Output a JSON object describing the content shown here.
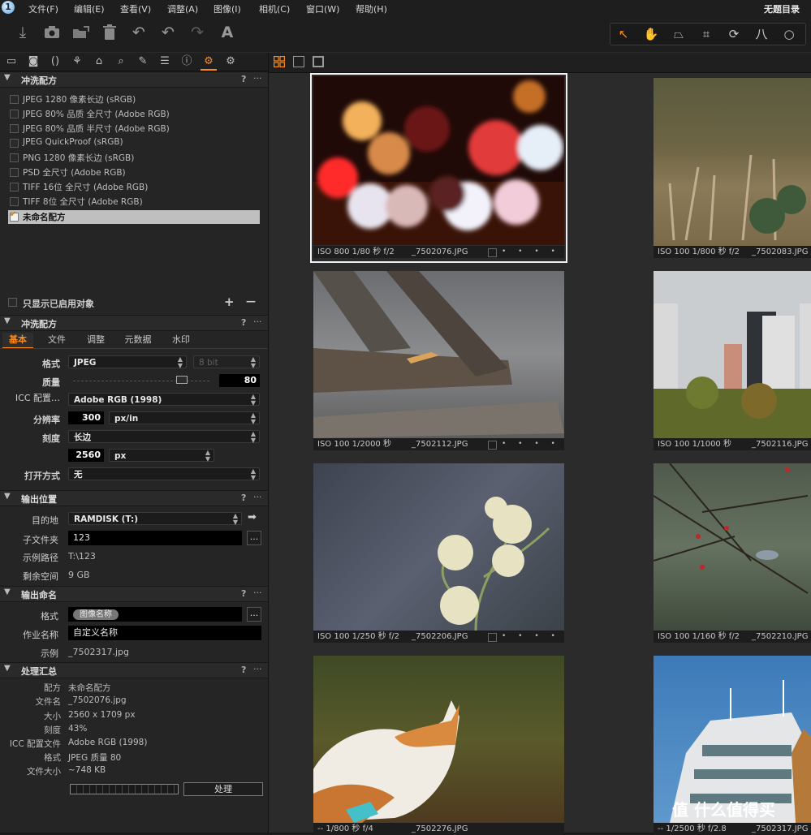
{
  "menubar": {
    "app_icon": "1",
    "items": [
      "文件(F)",
      "编辑(E)",
      "查看(V)",
      "调整(A)",
      "图像(I)",
      "相机(C)",
      "窗口(W)",
      "帮助(H)"
    ],
    "session_title": "无题目录"
  },
  "toolbar": {
    "icons": [
      "import-icon",
      "camera-icon",
      "export-icon",
      "trash-icon",
      "undo-all-icon",
      "undo-icon",
      "redo-icon",
      "auto-adjust-icon"
    ],
    "auto_adjust_glyph": "A",
    "cursor_tools": [
      "select-cursor-icon",
      "hand-icon",
      "keystone-icon",
      "crop-icon",
      "rotate-icon",
      "straighten-icon",
      "circle-icon"
    ]
  },
  "tool_tabs": [
    "folder-icon",
    "capture-icon",
    "lens-icon",
    "color-icon",
    "exposure-icon",
    "details-icon",
    "local-adjust-icon",
    "metadata-icon",
    "info-icon",
    "output-icon",
    "batch-icon"
  ],
  "recipes_section": {
    "title": "冲洗配方",
    "help": "?",
    "more": "···",
    "items": [
      {
        "label": "JPEG 1280 像素长边 (sRGB)",
        "checked": false
      },
      {
        "label": "JPEG 80% 品质 全尺寸 (Adobe RGB)",
        "checked": false
      },
      {
        "label": "JPEG 80% 品质 半尺寸 (Adobe RGB)",
        "checked": false
      },
      {
        "label": "JPEG QuickProof (sRGB)",
        "checked": false
      },
      {
        "label": "PNG 1280 像素长边 (sRGB)",
        "checked": false
      },
      {
        "label": "PSD 全尺寸 (Adobe RGB)",
        "checked": false
      },
      {
        "label": "TIFF 16位 全尺寸 (Adobe RGB)",
        "checked": false
      },
      {
        "label": "TIFF 8位 全尺寸 (Adobe RGB)",
        "checked": false
      },
      {
        "label": "未命名配方",
        "checked": true
      }
    ],
    "show_enabled_only": "只显示已启用对象",
    "add": "+",
    "remove": "—"
  },
  "recipe_settings": {
    "title": "冲洗配方",
    "tabs": [
      "基本",
      "文件",
      "调整",
      "元数据",
      "水印"
    ],
    "active_tab": "基本",
    "format_label": "格式",
    "format_value": "JPEG",
    "bit_value": "8 bit",
    "quality_label": "质量",
    "quality_value": 0.8,
    "quality_number": "80",
    "icc_label": "ICC 配置…",
    "icc_value": "Adobe RGB (1998)",
    "resolution_label": "分辨率",
    "resolution_value": "300",
    "resolution_unit": "px/in",
    "scale_label": "刻度",
    "scale_value": "长边",
    "size_value": "2560",
    "size_unit": "px",
    "open_with_label": "打开方式",
    "open_with_value": "无"
  },
  "output_location": {
    "title": "输出位置",
    "dest_label": "目的地",
    "dest_value": "RAMDISK (T:)",
    "subfolder_label": "子文件夹",
    "subfolder_value": "123",
    "sample_path_label": "示例路径",
    "sample_path_value": "T:\\123",
    "free_space_label": "剩余空间",
    "free_space_value": "9 GB",
    "browse": "..."
  },
  "output_naming": {
    "title": "输出命名",
    "format_label": "格式",
    "format_token": "图像名称",
    "job_name_label": "作业名称",
    "job_name_value": "自定义名称",
    "example_label": "示例",
    "example_value": "_7502317.jpg",
    "browse": "..."
  },
  "process_summary": {
    "title": "处理汇总",
    "rows": [
      {
        "k": "配方",
        "v": "未命名配方"
      },
      {
        "k": "文件名",
        "v": "_7502076.jpg"
      },
      {
        "k": "大小",
        "v": "2560 x 1709 px"
      },
      {
        "k": "刻度",
        "v": "43%"
      },
      {
        "k": "ICC 配置文件",
        "v": "Adobe RGB (1998)"
      },
      {
        "k": "格式",
        "v": "JPEG 质量 80"
      },
      {
        "k": "文件大小",
        "v": "~748 KB"
      }
    ],
    "process_button": "处理"
  },
  "viewer": {
    "view_modes": [
      "grid-view-icon",
      "single-view-icon",
      "full-view-icon"
    ],
    "thumbs": [
      {
        "exif": "ISO 800 1/80 秒 f/2",
        "file": "_7502076.JPG",
        "selected": true
      },
      {
        "exif": "ISO 100 1/800 秒 f/2",
        "file": "_7502083.JPG"
      },
      {
        "exif": "ISO 100 1/2000 秒",
        "file": "_7502112.JPG"
      },
      {
        "exif": "ISO 100 1/1000 秒",
        "file": "_7502116.JPG"
      },
      {
        "exif": "ISO 100 1/250 秒 f/2",
        "file": "_7502206.JPG"
      },
      {
        "exif": "ISO 100 1/160 秒 f/2",
        "file": "_7502210.JPG"
      },
      {
        "exif": "-- 1/800 秒 f/4",
        "file": "_7502276.JPG"
      },
      {
        "exif": "-- 1/2500 秒 f/2.8",
        "file": "_7502317.JPG"
      }
    ],
    "stars": "• • • • •"
  },
  "watermark": "值 什么值得买"
}
